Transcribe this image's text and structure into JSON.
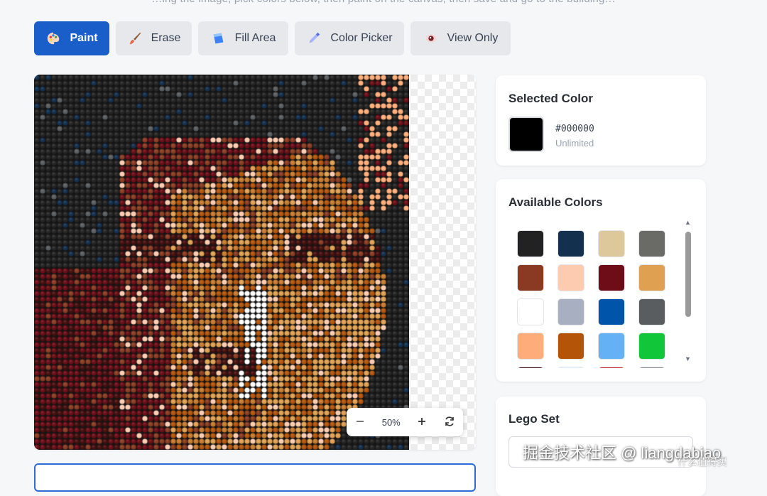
{
  "top_text": "…ing the image, pick colors below, then paint on the canvas, then save and go to the building…",
  "toolbar": {
    "buttons": [
      {
        "label": "Paint",
        "active": true
      },
      {
        "label": "Erase",
        "active": false
      },
      {
        "label": "Fill Area",
        "active": false
      },
      {
        "label": "Color Picker",
        "active": false
      },
      {
        "label": "View Only",
        "active": false
      }
    ]
  },
  "zoom": {
    "level": "50%"
  },
  "selected_color": {
    "title": "Selected Color",
    "hex": "#000000",
    "limit": "Unlimited",
    "color": "#000000"
  },
  "available_colors": {
    "title": "Available Colors",
    "colors": [
      "#222222",
      "#13304f",
      "#dcc89a",
      "#6a6b66",
      "#8a3a22",
      "#fdcbb0",
      "#6e0d17",
      "#e0a052",
      "#ffffff",
      "#a7afc1",
      "#0055aa",
      "#5a5d60",
      "#fdac7a",
      "#b35409",
      "#64b1f6",
      "#12c63a",
      "#4a1010",
      "#e6f4ff",
      "#c52a2a",
      "#8a9096"
    ]
  },
  "lego_set": {
    "title": "Lego Set"
  },
  "watermark": {
    "text": "掘金技术社区 @ liangdabiao",
    "sub": "什么值得买"
  }
}
